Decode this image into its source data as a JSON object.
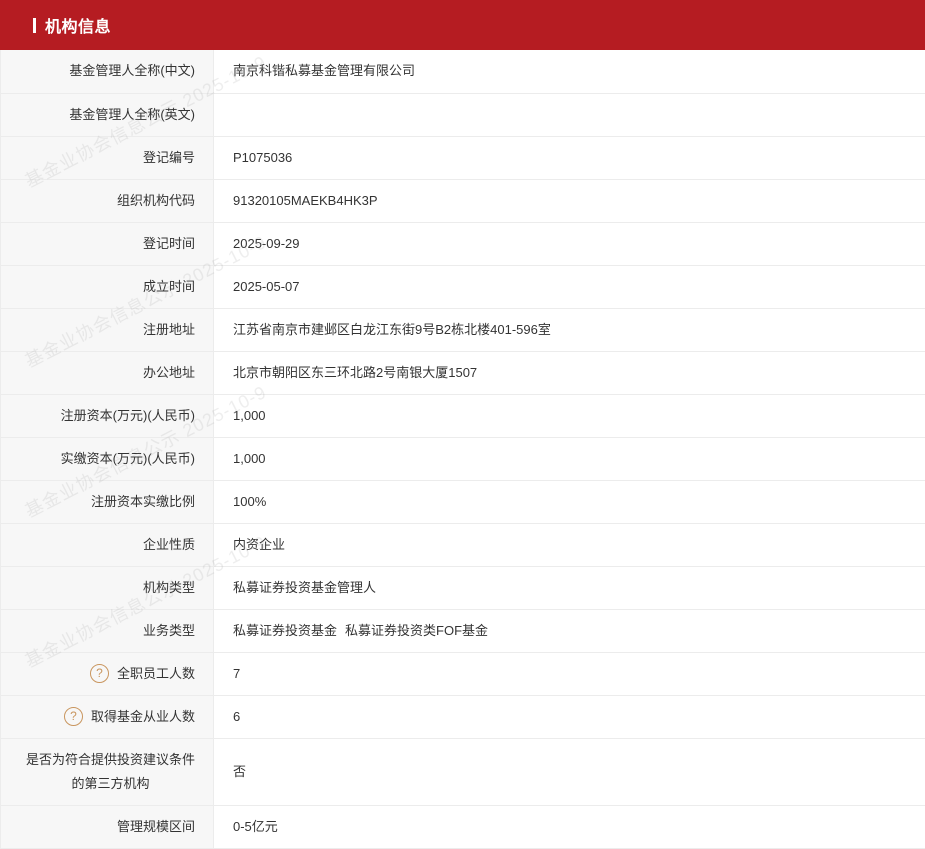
{
  "header": {
    "title": "机构信息"
  },
  "rows": [
    {
      "label": "基金管理人全称(中文)",
      "value": "南京科锴私募基金管理有限公司"
    },
    {
      "label": "基金管理人全称(英文)",
      "value": ""
    },
    {
      "label": "登记编号",
      "value": "P1075036"
    },
    {
      "label": "组织机构代码",
      "value": "91320105MAEKB4HK3P"
    },
    {
      "label": "登记时间",
      "value": "2025-09-29"
    },
    {
      "label": "成立时间",
      "value": "2025-05-07"
    },
    {
      "label": "注册地址",
      "value": "江苏省南京市建邺区白龙江东街9号B2栋北楼401-596室"
    },
    {
      "label": "办公地址",
      "value": "北京市朝阳区东三环北路2号南银大厦1507"
    },
    {
      "label": "注册资本(万元)(人民币)",
      "value": "1,000"
    },
    {
      "label": "实缴资本(万元)(人民币)",
      "value": "1,000"
    },
    {
      "label": "注册资本实缴比例",
      "value": "100%"
    },
    {
      "label": "企业性质",
      "value": "内资企业"
    },
    {
      "label": "机构类型",
      "value": "私募证券投资基金管理人"
    },
    {
      "label": "业务类型",
      "value": "私募证券投资基金",
      "value2": "私募证券投资类FOF基金"
    },
    {
      "label": "全职员工人数",
      "value": "7",
      "help_icon": "question-circle-icon"
    },
    {
      "label": "取得基金从业人数",
      "value": "6",
      "help_icon": "question-circle-icon"
    },
    {
      "label_line1": "是否为符合提供投资建议条件",
      "label_line2": "的第三方机构",
      "value": "否"
    },
    {
      "label": "管理规模区间",
      "value": "0-5亿元"
    }
  ],
  "help_icon_glyph": "?",
  "watermark": {
    "text": "基金业协会信息公示 2025-10-9"
  },
  "colors": {
    "header_bg": "#b51c22",
    "label_bg": "#f7f7f7",
    "help_icon": "#c9965f"
  }
}
